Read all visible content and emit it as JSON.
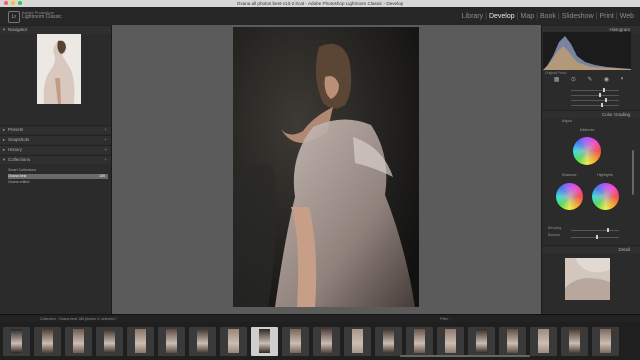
{
  "window": {
    "title": "Oxana all photos best-v13-2.lrcat - Adobe Photoshop Lightroom Classic - Develop"
  },
  "identity": {
    "company": "Adobe Photoshop",
    "app": "Lightroom Classic",
    "logo": "Lr"
  },
  "modules": [
    "Library",
    "Develop",
    "Map",
    "Book",
    "Slideshow",
    "Print",
    "Web"
  ],
  "active_module": "Develop",
  "left_panel": {
    "navigator": "Navigator",
    "presets": "Presets",
    "snapshots": "Snapshots",
    "history": "History",
    "collections": "Collections",
    "collection_rows": [
      {
        "label": "Smart Collections",
        "count": ""
      },
      {
        "label": "Oxana best",
        "count": "185"
      },
      {
        "label": "Oxana edited",
        "count": ""
      }
    ],
    "copy_label": "Copy...",
    "paste_label": "Paste"
  },
  "right_panel": {
    "histogram": "Histogram",
    "original_photo": "Original Photo",
    "color_grading": "Color Grading",
    "adjust": "Adjust",
    "midtones": "Midtones",
    "shadows": "Shadows",
    "highlights": "Highlights",
    "blending": "Blending",
    "balance": "Balance",
    "detail": "Detail",
    "prev_label": "Previous",
    "reset_label": "Reset"
  },
  "filmstrip_bar": {
    "info": "Collection : Oxana best  185 photos /1 selected /",
    "filter_label": "Filter :"
  },
  "colors": {
    "accent": "#ececec",
    "panel": "#2b2b2b",
    "canvas": "#5b5b5b"
  }
}
